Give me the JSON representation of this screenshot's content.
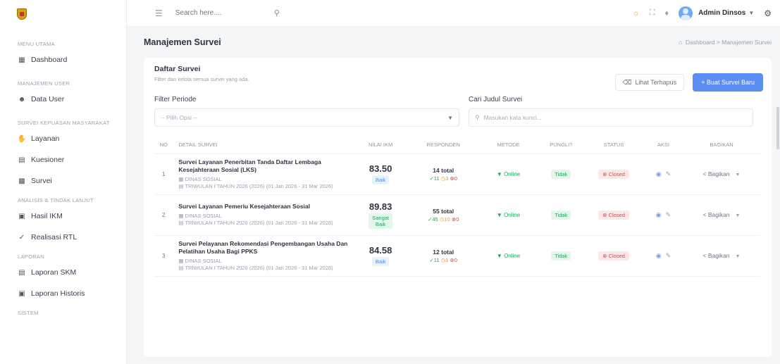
{
  "header": {
    "search_placeholder": "Search here....",
    "user_name": "Admin Dinsos"
  },
  "sidebar": {
    "sections": [
      {
        "title": "MENU UTAMA",
        "items": [
          {
            "label": "Dashboard",
            "icon": "grid-icon"
          }
        ]
      },
      {
        "title": "MANAJEMEN USER",
        "items": [
          {
            "label": "Data User",
            "icon": "users-icon"
          }
        ]
      },
      {
        "title": "SURVEI KEPUASAN MASYARAKAT",
        "items": [
          {
            "label": "Layanan",
            "icon": "hand-icon"
          },
          {
            "label": "Kuesioner",
            "icon": "form-icon"
          },
          {
            "label": "Survei",
            "icon": "document-icon"
          }
        ]
      },
      {
        "title": "ANALISIS & TINDAK LANJUT",
        "items": [
          {
            "label": "Hasil IKM",
            "icon": "chart-icon"
          },
          {
            "label": "Realisasi RTL",
            "icon": "check-circle-icon"
          }
        ]
      },
      {
        "title": "LAPORAN",
        "items": [
          {
            "label": "Laporan SKM",
            "icon": "report-icon"
          },
          {
            "label": "Laporan Historis",
            "icon": "history-icon"
          }
        ]
      },
      {
        "title": "SISTEM",
        "items": []
      }
    ]
  },
  "page": {
    "title": "Manajemen Survei",
    "breadcrumb_home": "Dashboard",
    "breadcrumb_sep": ">",
    "breadcrumb_current": "Manajemen Survei"
  },
  "card": {
    "title": "Daftar Survei",
    "subtitle": "Filter dan kelola semua survei yang ada.",
    "btn_deleted": "Lihat Terhapus",
    "btn_new": "+ Buat Survei Baru",
    "filter_periode_label": "Filter Periode",
    "filter_periode_placeholder": "-- Pilih Opsi --",
    "search_label": "Cari Judul Survei",
    "search_placeholder": "Masukan kata kunci..."
  },
  "table": {
    "columns": [
      "NO",
      "DETAIL SURVEI",
      "NILAI IKM",
      "RESPONDEN",
      "METODE",
      "PUNGLI?",
      "STATUS",
      "AKSI",
      "BAGIKAN"
    ],
    "rows": [
      {
        "no": "1",
        "title": "Survei Layanan Penerbitan Tanda Daftar Lembaga Kesejahteraan Sosial (LKS)",
        "org": "DINAS SOSIAL",
        "period": "TRIWULAN I TAHUN 2026 (2026) (01 Jan 2026 - 31 Mar 2026)",
        "ikm": "83.50",
        "ikm_label": "Baik",
        "resp_total": "14 total",
        "resp_green": "11",
        "resp_orange": "3",
        "resp_red": "0",
        "metode": "Online",
        "pungli": "Tidak",
        "status": "Closed",
        "share": "Bagikan"
      },
      {
        "no": "2",
        "title": "Survei Layanan Pemeriu Kesejahteraan Sosial",
        "org": "DINAS SOSIAL",
        "period": "TRIWULAN I TAHUN 2026 (2026) (01 Jan 2026 - 31 Mar 2026)",
        "ikm": "89.83",
        "ikm_label": "Sangat Baik",
        "resp_total": "55 total",
        "resp_green": "45",
        "resp_orange": "10",
        "resp_red": "0",
        "metode": "Online",
        "pungli": "Tidak",
        "status": "Closed",
        "share": "Bagikan"
      },
      {
        "no": "3",
        "title": "Survei Pelayanan Rekomendasi Pengembangan Usaha Dan Pelatihan Usaha Bagi PPKS",
        "org": "DINAS SOSIAL",
        "period": "TRIWULAN I TAHUN 2026 (2026) (01 Jan 2026 - 31 Mar 2026)",
        "ikm": "84.58",
        "ikm_label": "Baik",
        "resp_total": "12 total",
        "resp_green": "11",
        "resp_orange": "1",
        "resp_red": "0",
        "metode": "Online",
        "pungli": "Tidak",
        "status": "Closed",
        "share": "Bagikan"
      }
    ]
  }
}
